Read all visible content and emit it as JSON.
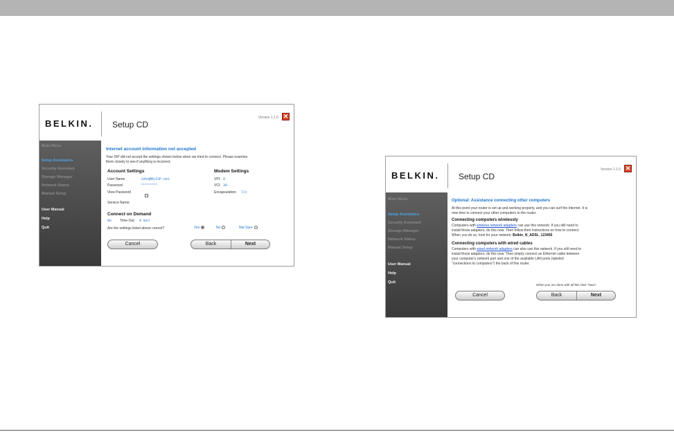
{
  "window1": {
    "logo": "BELKIN.",
    "title": "Setup CD",
    "version": "Version 1.1.0",
    "sidebar": {
      "main_menu": "Main Menu",
      "setup_assistant": "Setup Assistant  ▸",
      "security_assistant": "Security Assistant",
      "storage_manager": "Storage Manager",
      "network_status": "Network Status",
      "manual_setup": "Manual Setup",
      "user_manual": "User Manual",
      "help": "Help",
      "quit": "Quit"
    },
    "heading": "Internet account information not accepted",
    "intro_line1": "Your ISP did not accept the settings shown below when we tried to connect. Please examine",
    "intro_line2": "them closely to see if anything is incorrect.",
    "account_settings": {
      "title": "Account Settings",
      "username_label": "User Name",
      "username_value": "John@MyISP.net",
      "password_label": "Password",
      "password_value": "********",
      "view_password_label": "View Password",
      "service_name_label": "Service Name:"
    },
    "modem_settings": {
      "title": "Modem Settings",
      "vpi_label": "VPI:",
      "vpi_value": "0",
      "vci_label": "VCI:",
      "vci_value": "38",
      "encap_label": "Encapsulation:",
      "encap_value": "llc"
    },
    "connect_on_demand": {
      "title": "Connect on Demand",
      "value": "No",
      "timeout_label": "Time-Out:",
      "timeout_value": "0 min"
    },
    "question": "Are the settings listed above correct?",
    "answers": {
      "yes": "Yes",
      "no": "No",
      "not_sure": "Not Sure"
    },
    "buttons": {
      "cancel": "Cancel",
      "back": "Back",
      "next": "Next"
    }
  },
  "window2": {
    "logo": "BELKIN.",
    "title": "Setup CD",
    "version": "Version 1.1.0",
    "sidebar": {
      "main_menu": "Main Menu",
      "setup_assistant": "Setup Assistant  ▸",
      "security_assistant": "Security Assistant",
      "storage_manager": "Storage Manager",
      "network_status": "Network Status",
      "manual_setup": "Manual Setup",
      "user_manual": "User Manual",
      "help": "Help",
      "quit": "Quit"
    },
    "heading": "Optional: Assistance connecting other computers",
    "intro_line1": "At this point your router is set up and working properly, and you can surf the Internet. It is",
    "intro_line2": "now time to connect your other computers to the router.",
    "wireless": {
      "title": "Connecting computers wirelessly",
      "line1_pre": "Computers with ",
      "line1_link": "wireless network adapters",
      "line1_post": " can use this network. If you still need to",
      "line2": "install those adapters, do this now. Then follow their instructions on how to connect.",
      "line3_pre": "When you do so, look for your network: ",
      "network_name": "Belkin_N_ADSL_123456"
    },
    "wired": {
      "title": "Connecting computers with wired cables",
      "line1_pre": "Computers with ",
      "line1_link": "wired network adapters",
      "line1_post": " can also use this network. If you still need to",
      "line2": "install those adapters, do this now. Then simply connect an Ethernet cable between",
      "line3": "your computer's network port and one of the available LAN ports (labeled",
      "line4": "\"connections to computers\") the back of this router."
    },
    "done_note": "When you are done with all this click \"Next\".",
    "buttons": {
      "cancel": "Cancel",
      "back": "Back",
      "next": "Next"
    }
  }
}
